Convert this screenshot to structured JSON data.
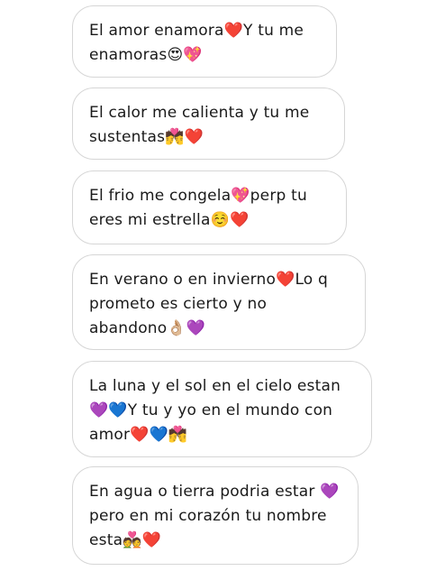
{
  "messages": [
    {
      "text": "El amor enamora❤️Y tu me enamoras😍💖"
    },
    {
      "text": "El calor me calienta y tu me sustentas💏❤️"
    },
    {
      "text": "El frio me congela💖perp tu eres mi estrella☺️❤️"
    },
    {
      "text": "En verano o en invierno❤️Lo q prometo es cierto y no abandono👌🏼💜"
    },
    {
      "text": "La luna y el sol en el cielo estan 💜💙Y tu y yo en el mundo con amor❤️💙💏"
    },
    {
      "text": "En agua o tierra podria estar 💜 pero en mi corazón tu nombre esta💑❤️"
    }
  ]
}
